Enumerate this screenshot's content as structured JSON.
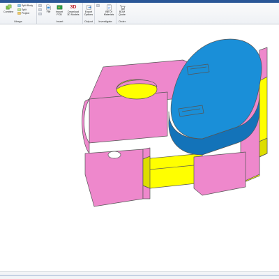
{
  "ribbon": {
    "merge_group": {
      "label": "Merge",
      "combine": "Combine",
      "split_body": "Split Body",
      "split": "Split",
      "project": "Project"
    },
    "insert_group": {
      "label": "Insert",
      "file": "File",
      "import_pcb": "Import PCB",
      "download_3d": "Download 3D Models",
      "download_3d_glyph": "3D"
    },
    "output_group": {
      "label": "Output",
      "export_options": "Export Options"
    },
    "investigate_group": {
      "label": "Investigate",
      "bill_of_materials": "Bill Of Materials"
    },
    "bom_group": {
      "label": "Order",
      "bom_quote": "BOM Quote"
    }
  },
  "colors": {
    "part_pink": "#ee88cc",
    "part_blue": "#1a8fd8",
    "part_yellow": "#ffff00",
    "ribbon_accent": "#2b5797"
  }
}
